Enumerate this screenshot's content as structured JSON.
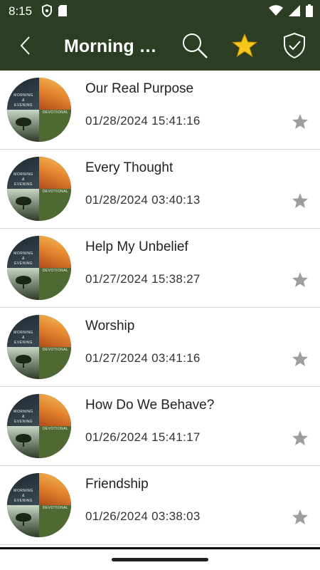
{
  "status_bar": {
    "time": "8:15"
  },
  "app_bar": {
    "title": "Morning and Evening",
    "back_icon": "chevron-left-icon",
    "search_icon": "search-icon",
    "favorites_icon": "star-icon",
    "check_icon": "shield-check-icon",
    "background_color": "#2b3d22",
    "favorite_color": "#f5c518"
  },
  "thumbnail": {
    "line1": "MORNING",
    "line2": "&",
    "line3": "EVENING",
    "line4": "DEVOTIONAL"
  },
  "items": [
    {
      "title": "Our Real Purpose",
      "date": "01/28/2024 15:41:16"
    },
    {
      "title": "Every Thought",
      "date": "01/28/2024 03:40:13"
    },
    {
      "title": "Help My Unbelief",
      "date": "01/27/2024 15:38:27"
    },
    {
      "title": "Worship",
      "date": "01/27/2024 03:41:16"
    },
    {
      "title": "How Do We Behave?",
      "date": "01/26/2024 15:41:17"
    },
    {
      "title": "Friendship",
      "date": "01/26/2024 03:38:03"
    }
  ]
}
